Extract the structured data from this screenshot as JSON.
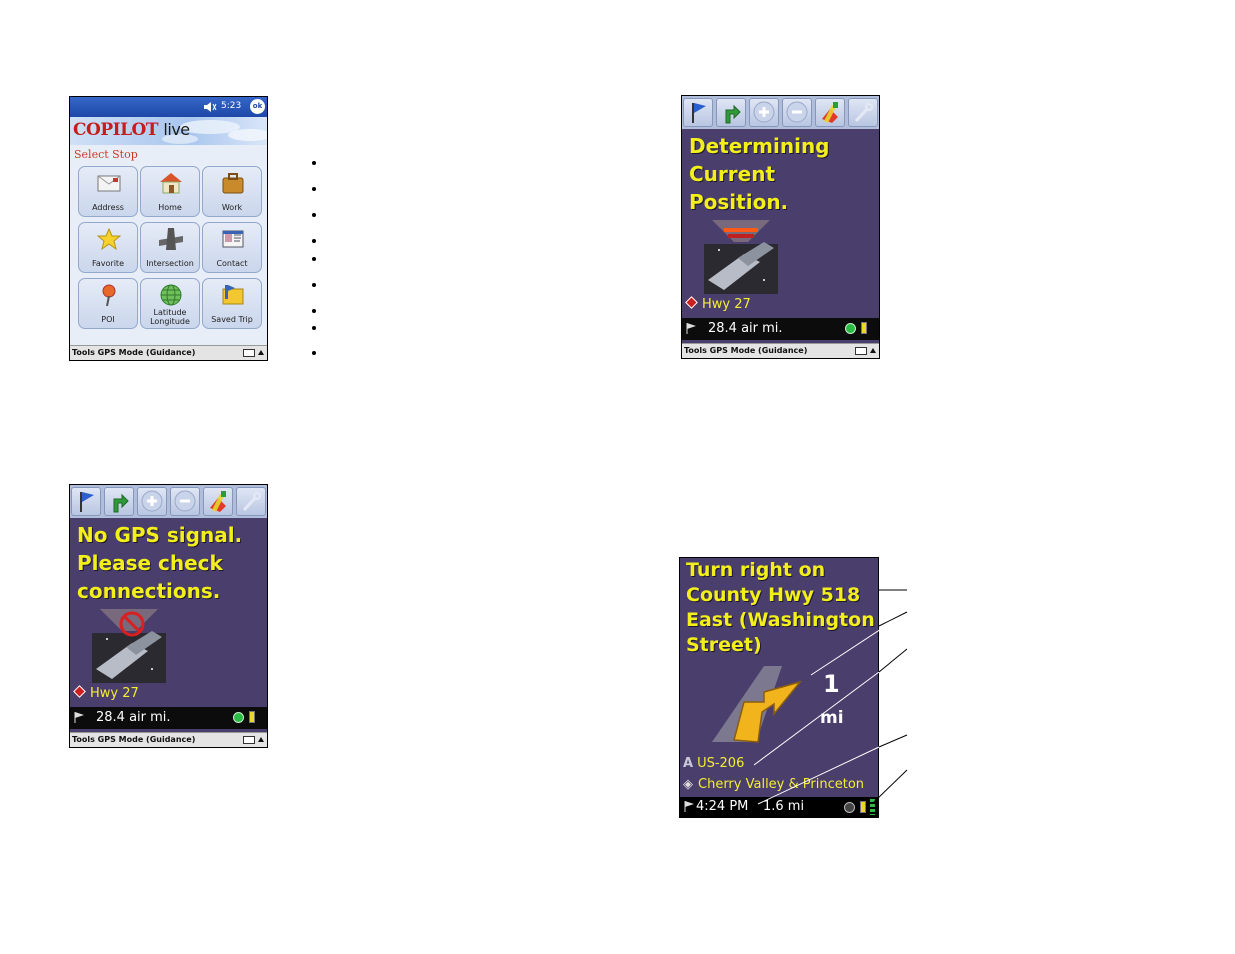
{
  "select_stop_screen": {
    "clock": "5:23",
    "ok_label": "ok",
    "logo_main": "COPILOT",
    "logo_sub": "live",
    "title": "Select Stop",
    "tiles": [
      {
        "label": "Address",
        "icon": "envelope-icon"
      },
      {
        "label": "Home",
        "icon": "house-icon"
      },
      {
        "label": "Work",
        "icon": "briefcase-icon"
      },
      {
        "label": "Favorite",
        "icon": "star-icon"
      },
      {
        "label": "Intersection",
        "icon": "intersection-icon"
      },
      {
        "label": "Contact",
        "icon": "contact-card-icon"
      },
      {
        "label": "POI",
        "icon": "pushpin-icon"
      },
      {
        "label": "Latitude\nLongitude",
        "icon": "globe-icon"
      },
      {
        "label": "Saved Trip",
        "icon": "folder-icon"
      }
    ],
    "command_bar": "Tools  GPS Mode (Guidance)"
  },
  "determining_screen": {
    "message": "Determining\nCurrent\nPosition.",
    "street": "Hwy 27",
    "distance": "28.4 air mi.",
    "command_bar": "Tools  GPS Mode (Guidance)"
  },
  "no_gps_screen": {
    "message": "No GPS signal.\nPlease check\nconnections.",
    "street": "Hwy 27",
    "distance": "28.4 air mi.",
    "command_bar": "Tools  GPS Mode (Guidance)"
  },
  "guidance_screen": {
    "instruction": "Turn right on\nCounty Hwy 518\nEast (Washington\nStreet)",
    "distance_value": "1",
    "distance_unit": "mi",
    "current_road": "US-206",
    "next_road": "Cherry Valley & Princeton",
    "eta": "4:24 PM",
    "remaining": "1.6 mi"
  },
  "toolbar_icons": [
    "flag-icon",
    "turn-arrow-icon",
    "zoom-in-icon",
    "zoom-out-icon",
    "detour-icon",
    "settings-wrench-icon"
  ],
  "colors": {
    "nav_background": "#4a3e6c",
    "nav_text": "#f2ef1a",
    "status_bar": "#0c0c0c",
    "copilot_red": "#c81b1b"
  }
}
